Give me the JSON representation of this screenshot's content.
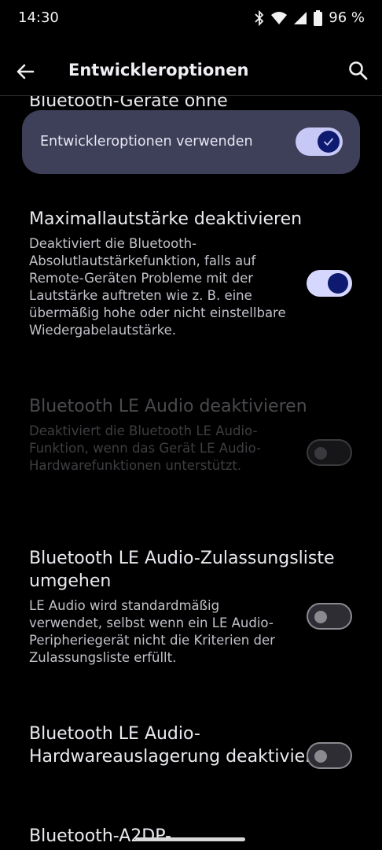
{
  "status_bar": {
    "time": "14:30",
    "battery": "96 %"
  },
  "app_bar": {
    "title": "Entwickleroptionen"
  },
  "master_switch": {
    "label": "Entwickleroptionen verwenden",
    "checked": true
  },
  "partial_top_title": "Bluetooth-Geräte ohne",
  "preferences": [
    {
      "title": "Maximallautstärke deaktivieren",
      "summary": "Deaktiviert die Bluetooth-Absolutlautstärkefunktion, falls auf Remote-Geräten Probleme mit der Lautstärke auftreten wie z. B. eine übermäßig hohe oder nicht einstellbare Wiedergabelautstärke.",
      "checked": true,
      "enabled": true
    },
    {
      "title": "Bluetooth LE Audio deaktivieren",
      "summary": "Deaktiviert die Bluetooth LE Audio-Funktion, wenn das Gerät LE Audio-Hardwarefunktionen unterstützt.",
      "checked": false,
      "enabled": false
    },
    {
      "title": "Bluetooth LE Audio-Zulassungsliste umgehen",
      "summary": "LE Audio wird standardmäßig verwendet, selbst wenn ein LE Audio-Peripheriegerät nicht die Kriterien der Zulassungsliste erfüllt.",
      "checked": false,
      "enabled": true
    },
    {
      "title": "Bluetooth LE Audio-Hardwareauslagerung deaktivieren",
      "summary": "",
      "checked": false,
      "enabled": true
    }
  ],
  "partial_bottom_title": "Bluetooth-A2DP-",
  "icons": {
    "back": "arrow-back-icon",
    "search": "search-icon",
    "bluetooth": "bluetooth-icon",
    "wifi": "wifi-icon",
    "signal": "signal-icon",
    "battery": "battery-icon",
    "check": "check-icon"
  },
  "colors": {
    "background": "#000000",
    "switch_on_track": "#d6d7ff",
    "switch_on_thumb": "#0e1a6f",
    "master_card": "#3e3f58"
  }
}
